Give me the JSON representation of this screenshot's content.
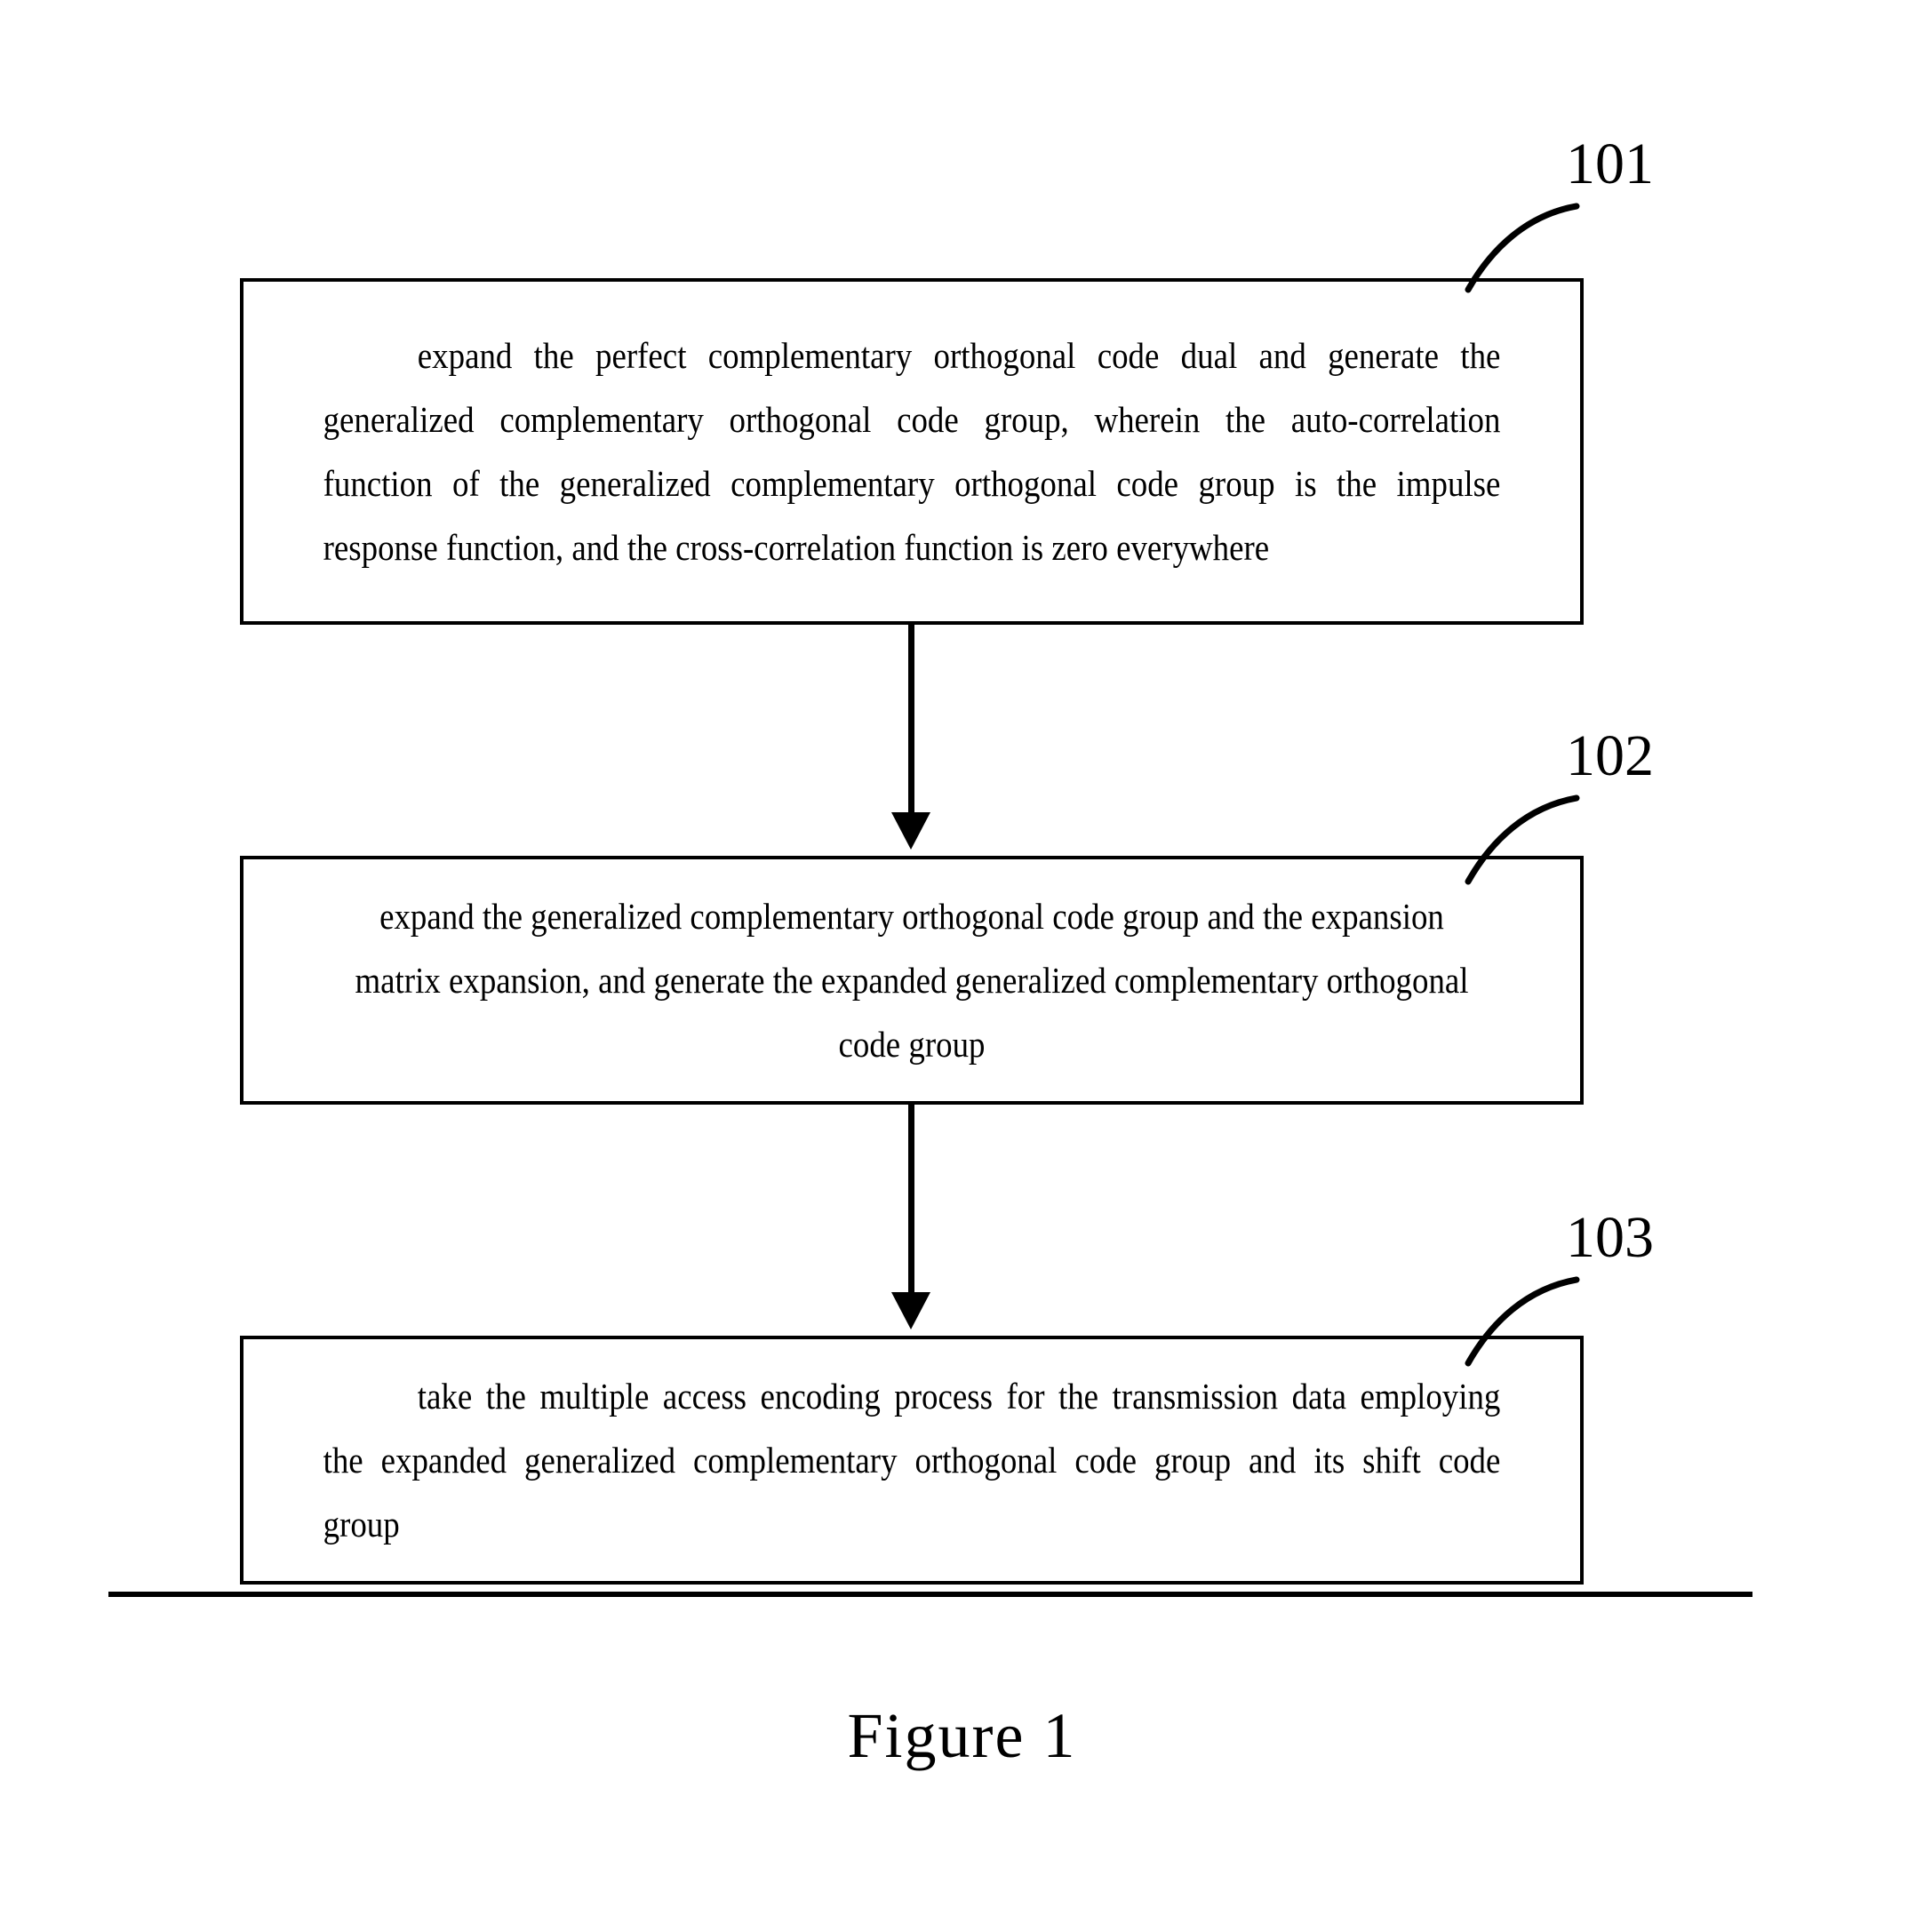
{
  "figure": {
    "caption": "Figure  1"
  },
  "steps": [
    {
      "number": "101",
      "lines": [
        "expand the perfect complementary orthogonal code dual and generate the",
        "generalized complementary orthogonal code group, wherein the auto-correlation",
        "function of the generalized complementary orthogonal code group is the impulse",
        "response function, and the cross-correlation function is zero everywhere"
      ],
      "full_text": "expand the perfect complementary orthogonal code dual and generate the generalized complementary orthogonal code group, wherein the auto-correlation function of the generalized complementary orthogonal code group is the impulse response function, and the cross-correlation function is zero everywhere"
    },
    {
      "number": "102",
      "lines": [
        "expand the generalized complementary orthogonal code group and the expansion",
        "matrix expansion, and generate the expanded generalized complementary orthogonal",
        "code group"
      ],
      "full_text": "expand the generalized complementary orthogonal code group and the expansion matrix expansion, and generate the expanded generalized complementary orthogonal code group"
    },
    {
      "number": "103",
      "lines": [
        "take the multiple access encoding process for the transmission data employing",
        "the expanded generalized complementary orthogonal code group and its shift code",
        "group"
      ],
      "full_text": "take the multiple access encoding process for the transmission data employing the expanded generalized complementary orthogonal code group and its shift code group"
    }
  ],
  "colors": {
    "stroke": "#000000",
    "background": "#ffffff",
    "text": "#000000"
  }
}
